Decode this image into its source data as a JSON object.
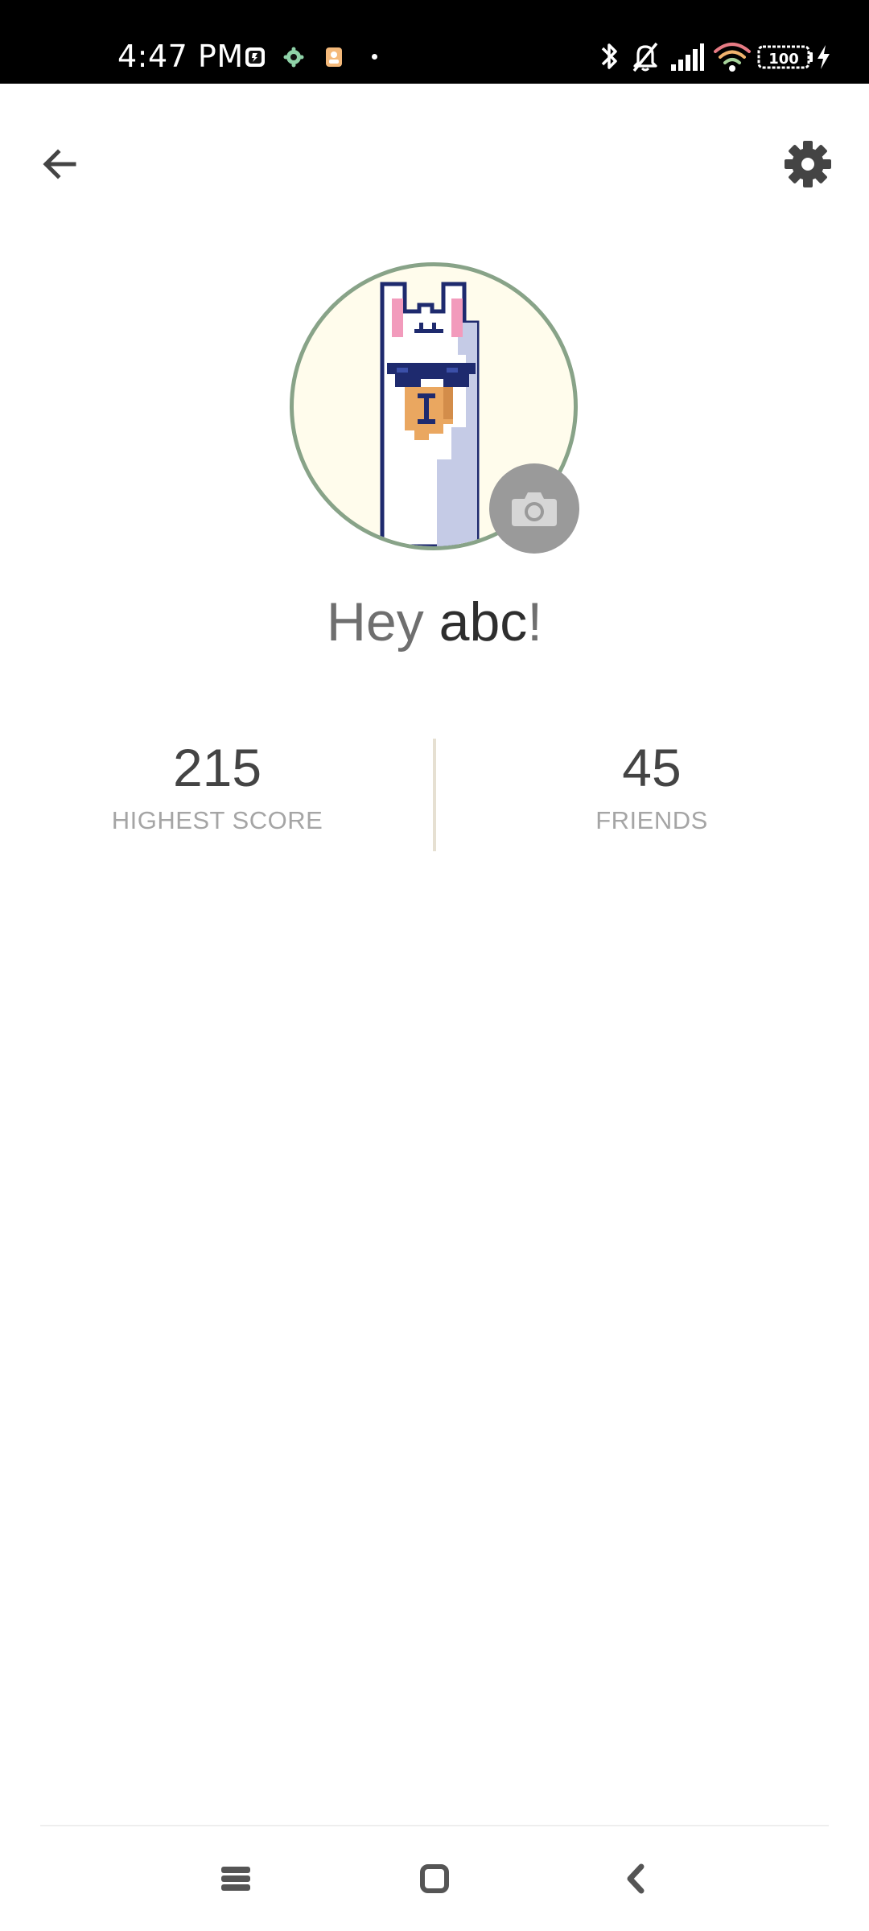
{
  "status_bar": {
    "time": "4:47 PM",
    "notification_icons": [
      "app-notification-icon",
      "settings-notification-icon",
      "contact-notification-icon"
    ],
    "system_icons": [
      "bluetooth-icon",
      "bell-off-icon",
      "cellular-signal-icon",
      "wifi-icon",
      "battery-icon",
      "charging-icon"
    ],
    "battery_text": "100"
  },
  "app_bar": {
    "back_icon": "arrow-left-icon",
    "settings_icon": "gear-icon"
  },
  "profile": {
    "greeting_prefix": "Hey ",
    "username": "abc",
    "greeting_suffix": "!",
    "avatar": "pixel-llama-with-sunglasses",
    "camera_icon": "camera-icon"
  },
  "stats": [
    {
      "value": "215",
      "label": "HIGHEST SCORE"
    },
    {
      "value": "45",
      "label": "FRIENDS"
    }
  ],
  "nav_bar": {
    "icons": [
      "recent-apps-icon",
      "home-icon",
      "back-nav-icon"
    ]
  },
  "colors": {
    "status_bar_bg": "#000000",
    "avatar_ring": "#88a388",
    "avatar_bg": "#fffcec",
    "camera_button_bg": "#9a9a9a",
    "stat_value": "#444444",
    "stat_label": "#a5a5a5"
  }
}
